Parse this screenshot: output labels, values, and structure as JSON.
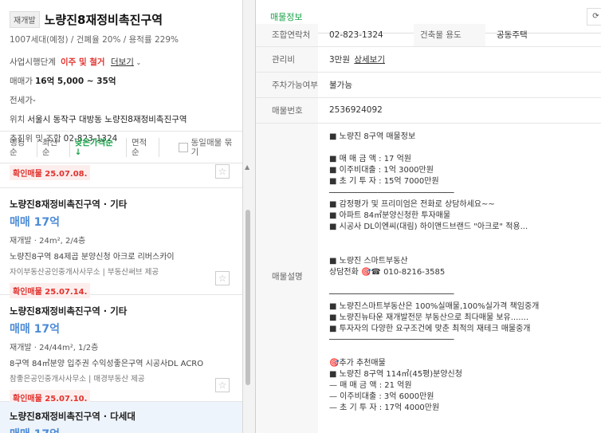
{
  "summary": {
    "tag": "재개발",
    "title": "노량진8재정비촉진구역",
    "sub": "1007세대(예정) / 건폐율 20% / 용적률 229%",
    "stage_label": "사업시행단계",
    "stage_value": "이주 및 철거",
    "more": "더보기",
    "sale_label": "매매가",
    "sale_value": "16억 5,000 ~ 35억",
    "jeonse_label": "전세가",
    "jeonse_value": "-",
    "loc_label": "위치",
    "loc_value": "서울시 동작구 대방동 노량진8재정비촉진구역",
    "assoc_label": "추진위 및 조합",
    "assoc_value": "02-823-1324"
  },
  "sort": {
    "options": [
      "랭킹순",
      "최신순",
      "낮은가격순 ↓",
      "면적순"
    ],
    "same_label": "동일매물 묶기"
  },
  "listings": [
    {
      "badge": "확인매물 25.07.08."
    },
    {
      "title": "노량진8재정비촉진구역 · 기타",
      "price": "매매 17억",
      "detail": "재개발 · 24m², 2/4층",
      "desc": "노량진8구역 84제곱 분양신청 아크로 리버스카이",
      "agent": "자이부동산공인중개사사무소 | 부동산써브 제공",
      "badge": "확인매물 25.07.14."
    },
    {
      "title": "노량진8재정비촉진구역 · 기타",
      "price": "매매 17억",
      "detail": "재개발 · 24/44m², 1/2층",
      "desc": "8구역 84㎡분양 입주권 수익성좋은구역 시공사DL ACRO",
      "agent": "참좋은공인중개사사무소 | 매경부동산 제공",
      "badge": "확인매물 25.07.10."
    },
    {
      "title": "노량진8재정비촉진구역 · 다세대",
      "price": "매매 17억"
    }
  ],
  "right": {
    "tab": "매물정보",
    "rows": [
      {
        "k": "조합연락처",
        "v": "02-823-1324",
        "k2": "건축물 용도",
        "v2": "공동주택"
      },
      {
        "k": "관리비",
        "v": "3만원",
        "link": "상세보기"
      },
      {
        "k": "주차가능여부",
        "v": "불가능"
      },
      {
        "k": "매물번호",
        "v": "2536924092"
      }
    ],
    "desc_label": "매물설명",
    "desc_text": "■ 노량진 8구역 매물정보\n\n■ 매 매 금 액 : 17 억원\n■ 이주비대출 : 1억 3000만원\n■ 초 기 투 자 : 15억 7000만원\n──────────────────────────\n■ 감정평가 및 프리미엄은 전화로 상담하세요~~\n■ 아파트 84㎡분양신청한 투자매물\n■ 시공사 DL이엔씨(대림) 하이앤드브랜드 \"아크로\" 적용...\n\n\n■ 노량진 스마트부동산\n상담전화 🎯☎ 010-8216-3585\n\n──────────────────────────\n■ 노량진스마트부동산은 100%실매물,100%실가격 책임중개\n■ 노량진뉴타운 재개발전문 부동산으로 최다매물 보유.......\n■ 투자자의 다양한 요구조건에 맞춘 최적의 재테크 매물중개\n──────────────────────────\n\n🎯추가 추천매물\n■ 노량진 8구역 114㎡(45평)분양신청\n— 매 매 금 액 : 21 억원\n— 이주비대출 : 3억 6000만원\n— 초 기 투 자 : 17억 4000만원"
  }
}
